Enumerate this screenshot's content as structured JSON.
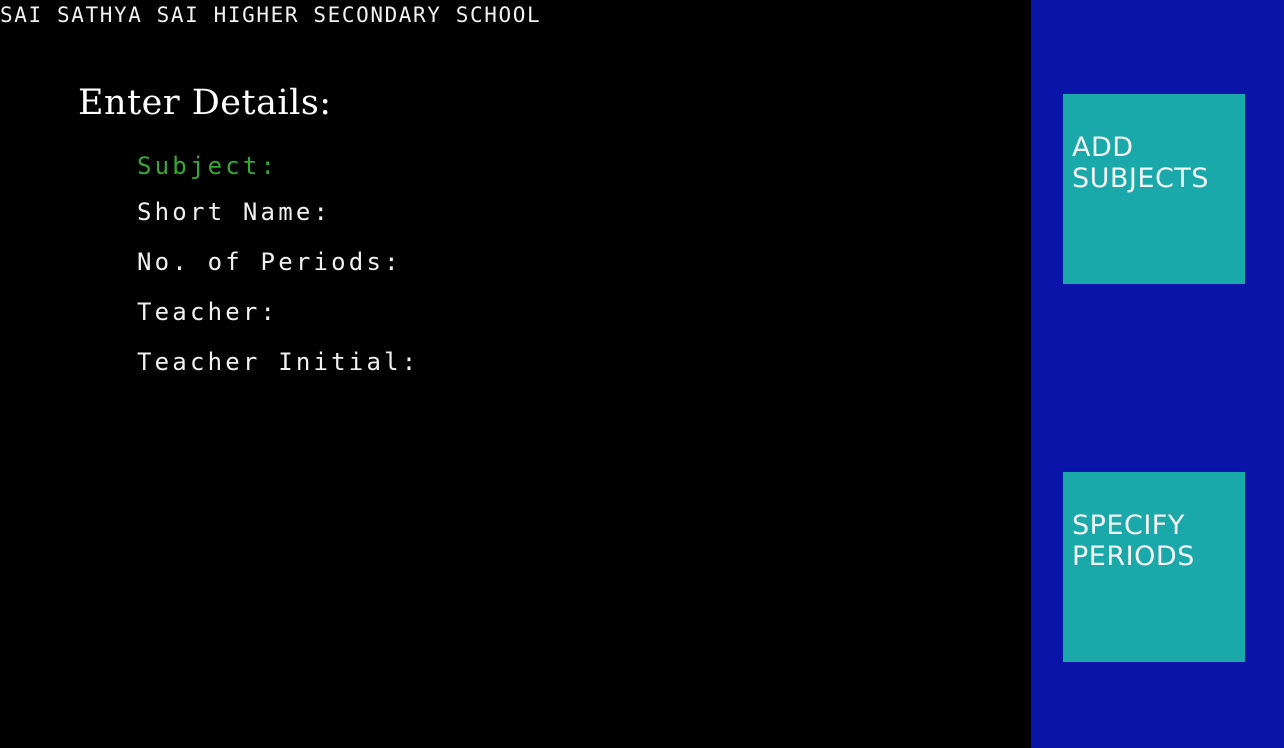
{
  "app": {
    "school_name": "SAI SATHYA SAI HIGHER SECONDARY SCHOOL"
  },
  "form": {
    "heading": "Enter Details:",
    "fields": [
      {
        "label": "Subject:",
        "active": true
      },
      {
        "label": "Short Name:",
        "active": false
      },
      {
        "label": "No. of Periods:",
        "active": false
      },
      {
        "label": "Teacher:",
        "active": false
      },
      {
        "label": "Teacher Initial:",
        "active": false
      }
    ]
  },
  "sidebar": {
    "buttons": [
      {
        "line1": "ADD",
        "line2": "SUBJECTS"
      },
      {
        "line1": "SPECIFY",
        "line2": "PERIODS"
      }
    ]
  },
  "colors": {
    "background": "#000000",
    "sidebar": "#0a14a8",
    "button": "#1aa8aa",
    "active_field": "#34a834",
    "text": "#f0f0f0"
  }
}
